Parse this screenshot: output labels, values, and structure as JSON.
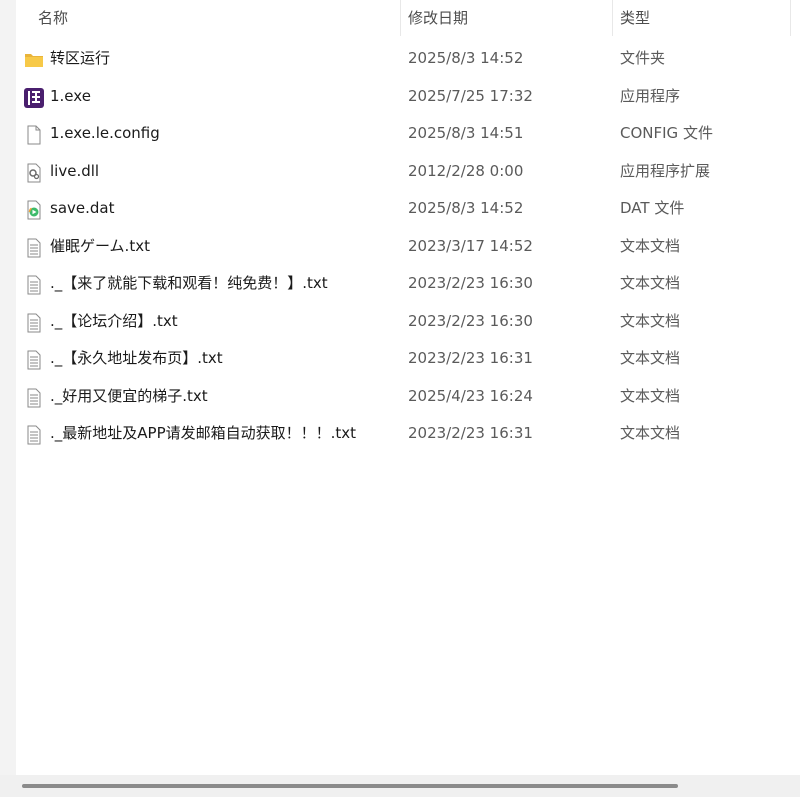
{
  "columns": {
    "name": "名称",
    "date": "修改日期",
    "type": "类型"
  },
  "sort_indicator": "^",
  "files": [
    {
      "icon": "folder-icon",
      "name": "转区运行",
      "date": "2025/8/3 14:52",
      "type": "文件夹"
    },
    {
      "icon": "app-exe-icon",
      "name": "1.exe",
      "date": "2025/7/25 17:32",
      "type": "应用程序"
    },
    {
      "icon": "blank-file-icon",
      "name": "1.exe.le.config",
      "date": "2025/8/3 14:51",
      "type": "CONFIG 文件"
    },
    {
      "icon": "dll-gear-file-icon",
      "name": "live.dll",
      "date": "2012/2/28 0:00",
      "type": "应用程序扩展"
    },
    {
      "icon": "media-play-file-icon",
      "name": "save.dat",
      "date": "2025/8/3 14:52",
      "type": "DAT 文件"
    },
    {
      "icon": "text-file-icon",
      "name": "催眠ゲーム.txt",
      "date": "2023/3/17 14:52",
      "type": "文本文档"
    },
    {
      "icon": "text-file-icon",
      "name": "._【来了就能下载和观看！纯免费！】.txt",
      "date": "2023/2/23 16:30",
      "type": "文本文档"
    },
    {
      "icon": "text-file-icon",
      "name": "._【论坛介绍】.txt",
      "date": "2023/2/23 16:30",
      "type": "文本文档"
    },
    {
      "icon": "text-file-icon",
      "name": "._【永久地址发布页】.txt",
      "date": "2023/2/23 16:31",
      "type": "文本文档"
    },
    {
      "icon": "text-file-icon",
      "name": "._好用又便宜的梯子.txt",
      "date": "2025/4/23 16:24",
      "type": "文本文档"
    },
    {
      "icon": "text-file-icon",
      "name": "._最新地址及APP请发邮箱自动获取！！！.txt",
      "date": "2023/2/23 16:31",
      "type": "文本文档"
    }
  ],
  "colors": {
    "folder": "#f7c948",
    "app_icon": "#5b2a86",
    "scroll_thumb": "#8b8b8b"
  }
}
